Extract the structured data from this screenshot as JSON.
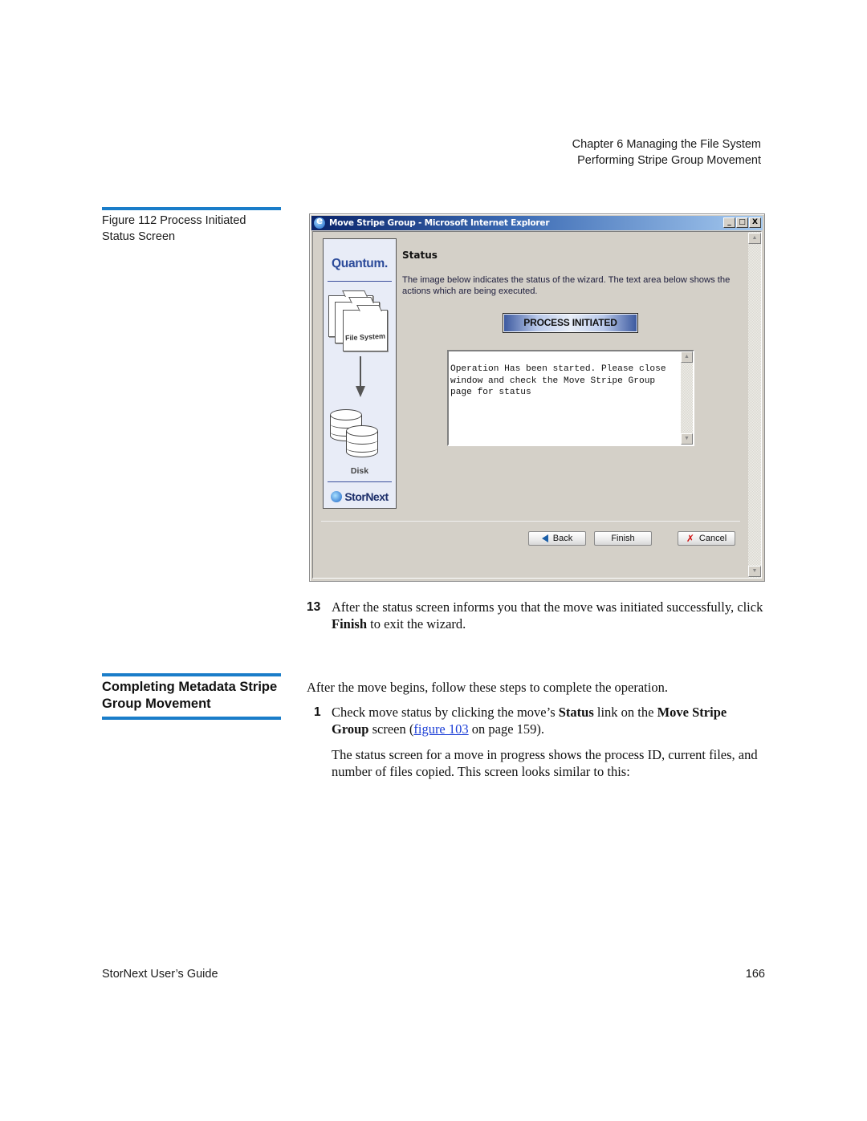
{
  "header": {
    "chapter": "Chapter 6  Managing the File System",
    "section": "Performing Stripe Group Movement"
  },
  "figure": {
    "caption": "Figure 112  Process Initiated Status Screen"
  },
  "screenshot": {
    "window_title": "Move Stripe Group - Microsoft Internet Explorer",
    "window_controls": {
      "minimize": "_",
      "maximize": "□",
      "close": "X"
    },
    "left_panel": {
      "brand_top": "Quantum.",
      "folder_label": "File System",
      "disk_label": "Disk",
      "brand_bottom": "StorNext"
    },
    "status_heading": "Status",
    "status_description": "The image below indicates the status of the wizard. The text area below shows the actions which are being executed.",
    "status_badge": "PROCESS INITIATED",
    "log_text": "Operation Has been started. Please close window and check the Move Stripe Group page for status",
    "buttons": {
      "back": "Back",
      "finish": "Finish",
      "cancel": "Cancel"
    },
    "scroll_up": "▲",
    "scroll_down": "▼"
  },
  "step13": {
    "number": "13",
    "text_before": "After the status screen informs you that the move was initiated successfully, click ",
    "bold": "Finish",
    "text_after": " to exit the wizard."
  },
  "section": {
    "heading": "Completing Metadata Stripe Group Movement",
    "intro": "After the move begins, follow these steps to complete the operation.",
    "step1": {
      "number": "1",
      "t1": "Check move status by clicking the move’s ",
      "b1": "Status",
      "t2": " link on the ",
      "b2": "Move Stripe Group",
      "t3": " screen (",
      "link": "figure 103",
      "t4": " on page 159)."
    },
    "followup": "The status screen for a move in progress shows the process ID, current files, and number of files copied. This screen looks similar to this:"
  },
  "footer": {
    "guide_title": "StorNext User’s Guide",
    "page_number": "166"
  },
  "colors": {
    "accent_rule": "#1a7dc9",
    "link": "#1a3dd6",
    "titlebar_start": "#0a246a",
    "titlebar_end": "#a6caf0"
  }
}
